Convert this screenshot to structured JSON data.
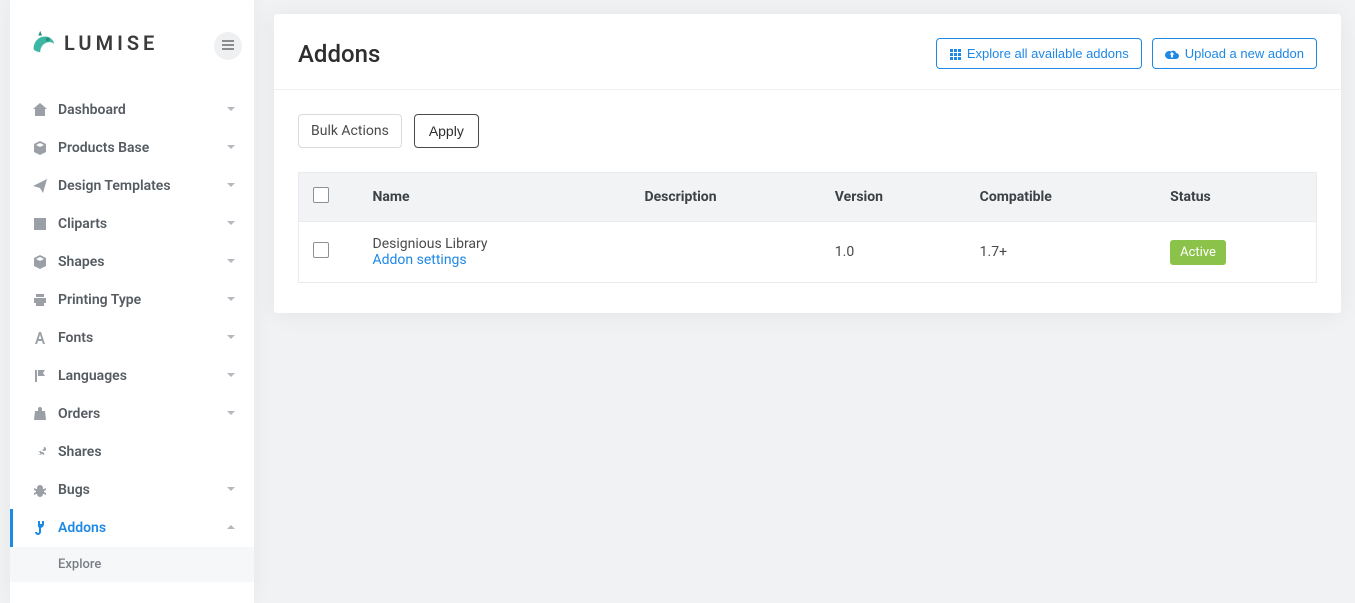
{
  "brand": {
    "name": "LUMISE"
  },
  "sidebar": {
    "items": [
      {
        "label": "Dashboard",
        "icon": "home",
        "expandable": true
      },
      {
        "label": "Products Base",
        "icon": "cube",
        "expandable": true
      },
      {
        "label": "Design Templates",
        "icon": "paper-plane",
        "expandable": true
      },
      {
        "label": "Cliparts",
        "icon": "image",
        "expandable": true
      },
      {
        "label": "Shapes",
        "icon": "cube",
        "expandable": true
      },
      {
        "label": "Printing Type",
        "icon": "printer",
        "expandable": true
      },
      {
        "label": "Fonts",
        "icon": "font",
        "expandable": true
      },
      {
        "label": "Languages",
        "icon": "flag",
        "expandable": true
      },
      {
        "label": "Orders",
        "icon": "bag",
        "expandable": true
      },
      {
        "label": "Shares",
        "icon": "share",
        "expandable": false
      },
      {
        "label": "Bugs",
        "icon": "bug",
        "expandable": true
      },
      {
        "label": "Addons",
        "icon": "plug",
        "expandable": true,
        "active": true
      }
    ],
    "sub": {
      "label": "Explore"
    }
  },
  "page": {
    "title": "Addons",
    "explore_btn": "Explore all available addons",
    "upload_btn": "Upload a new addon"
  },
  "toolbar": {
    "bulk_label": "Bulk Actions",
    "apply_label": "Apply"
  },
  "table": {
    "headers": {
      "name": "Name",
      "description": "Description",
      "version": "Version",
      "compatible": "Compatible",
      "status": "Status"
    },
    "rows": [
      {
        "name": "Designious Library",
        "settings_link": "Addon settings",
        "description": "",
        "version": "1.0",
        "compatible": "1.7+",
        "status": "Active"
      }
    ]
  },
  "colors": {
    "primary": "#1e88e5",
    "badge_success": "#8bc34a"
  }
}
